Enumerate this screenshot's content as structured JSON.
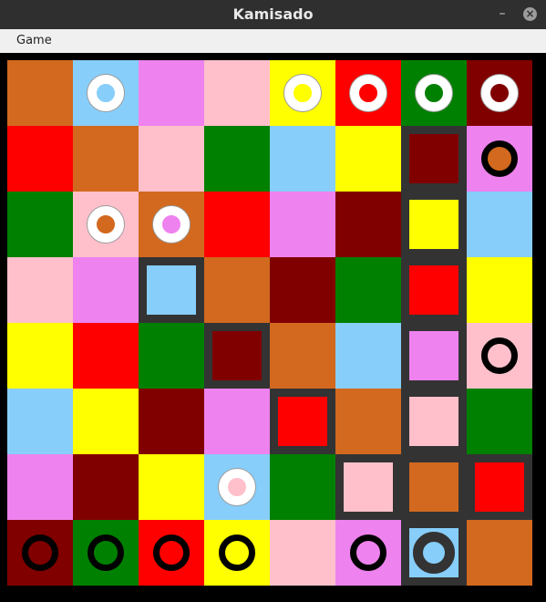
{
  "window": {
    "title": "Kamisado",
    "minimize_glyph": "–",
    "close_glyph": "×"
  },
  "menu": {
    "items": [
      "Game"
    ]
  },
  "colors": {
    "orange": "#d2691e",
    "blue": "#87cefa",
    "purple": "#ee82ee",
    "pink": "#ffc0cb",
    "yellow": "#ffff00",
    "red": "#ff0000",
    "green": "#008000",
    "brown": "#800000",
    "white": "#ffffff",
    "black": "#000000",
    "highlight": "#333333"
  },
  "board": {
    "rows": [
      [
        "orange",
        "blue",
        "purple",
        "pink",
        "yellow",
        "red",
        "green",
        "brown"
      ],
      [
        "red",
        "orange",
        "pink",
        "green",
        "blue",
        "yellow",
        "brown",
        "purple"
      ],
      [
        "green",
        "pink",
        "orange",
        "red",
        "purple",
        "brown",
        "yellow",
        "blue"
      ],
      [
        "pink",
        "purple",
        "blue",
        "orange",
        "brown",
        "green",
        "red",
        "yellow"
      ],
      [
        "yellow",
        "red",
        "green",
        "brown",
        "orange",
        "blue",
        "purple",
        "pink"
      ],
      [
        "blue",
        "yellow",
        "brown",
        "purple",
        "red",
        "orange",
        "pink",
        "green"
      ],
      [
        "purple",
        "brown",
        "yellow",
        "blue",
        "green",
        "pink",
        "orange",
        "red"
      ],
      [
        "brown",
        "green",
        "red",
        "yellow",
        "pink",
        "purple",
        "blue",
        "orange"
      ]
    ],
    "highlighted_cells": [
      [
        1,
        6
      ],
      [
        2,
        6
      ],
      [
        3,
        2
      ],
      [
        3,
        6
      ],
      [
        4,
        3
      ],
      [
        4,
        6
      ],
      [
        5,
        4
      ],
      [
        5,
        6
      ],
      [
        6,
        5
      ],
      [
        6,
        6
      ],
      [
        6,
        7
      ],
      [
        7,
        6
      ]
    ],
    "pieces": [
      {
        "player": "white",
        "color": "blue",
        "row": 0,
        "col": 1
      },
      {
        "player": "white",
        "color": "yellow",
        "row": 0,
        "col": 4
      },
      {
        "player": "white",
        "color": "red",
        "row": 0,
        "col": 5
      },
      {
        "player": "white",
        "color": "green",
        "row": 0,
        "col": 6
      },
      {
        "player": "white",
        "color": "brown",
        "row": 0,
        "col": 7
      },
      {
        "player": "white",
        "color": "orange",
        "row": 2,
        "col": 1
      },
      {
        "player": "white",
        "color": "purple",
        "row": 2,
        "col": 2
      },
      {
        "player": "white",
        "color": "pink",
        "row": 6,
        "col": 3
      },
      {
        "player": "black",
        "color": "orange",
        "row": 1,
        "col": 7
      },
      {
        "player": "black",
        "color": "pink",
        "row": 4,
        "col": 7
      },
      {
        "player": "black",
        "color": "brown",
        "row": 7,
        "col": 0
      },
      {
        "player": "black",
        "color": "green",
        "row": 7,
        "col": 1
      },
      {
        "player": "black",
        "color": "red",
        "row": 7,
        "col": 2
      },
      {
        "player": "black",
        "color": "yellow",
        "row": 7,
        "col": 3
      },
      {
        "player": "black",
        "color": "purple",
        "row": 7,
        "col": 5
      },
      {
        "player": "black",
        "color": "blue",
        "row": 7,
        "col": 6,
        "selected": true
      }
    ]
  }
}
